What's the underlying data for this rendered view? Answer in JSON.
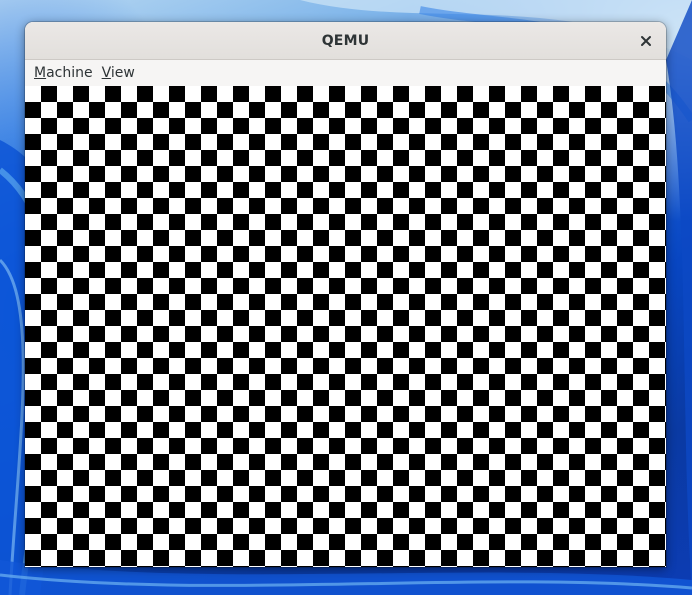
{
  "window": {
    "title": "QEMU"
  },
  "menubar": {
    "items": [
      {
        "mnemonic": "M",
        "rest": "achine"
      },
      {
        "mnemonic": "V",
        "rest": "iew"
      }
    ]
  },
  "icons": {
    "close": "close-icon"
  },
  "display": {
    "pattern": "checkerboard",
    "colors": [
      "#000000",
      "#ffffff"
    ]
  },
  "desktop": {
    "wallpaper_colors": [
      "#b9d9f2",
      "#1d63d9",
      "#0a3aa3"
    ]
  }
}
